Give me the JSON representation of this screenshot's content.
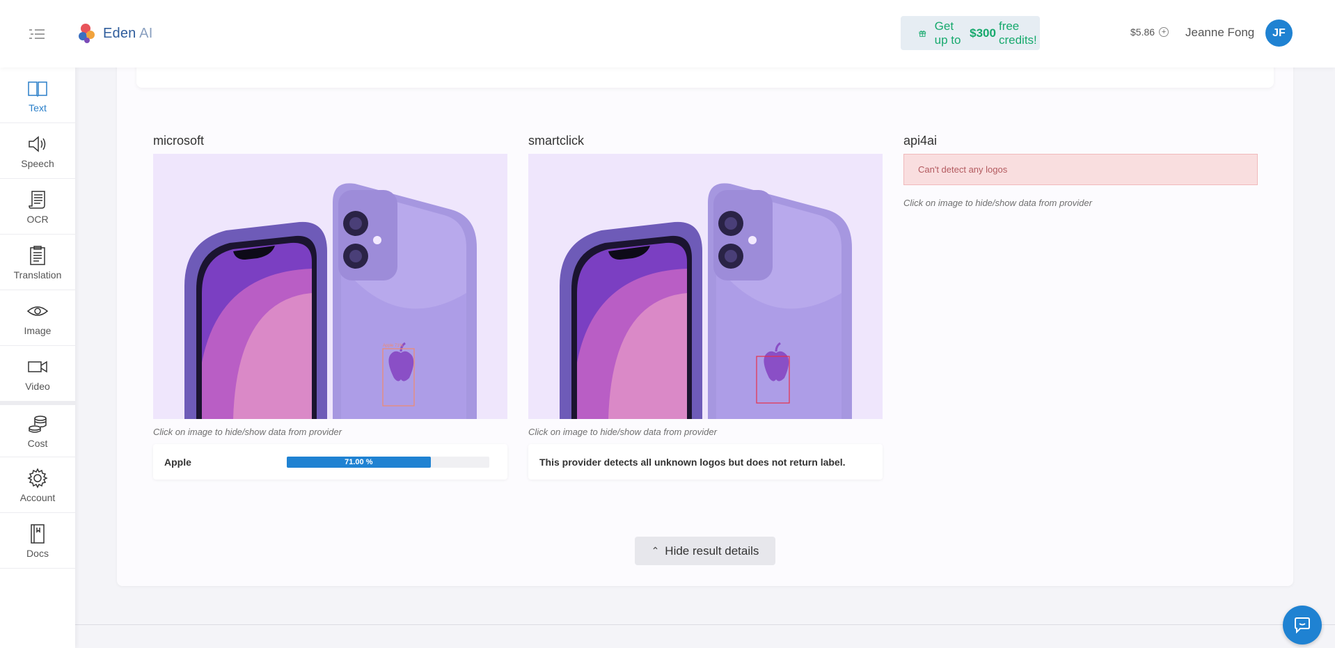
{
  "app": {
    "logo_text": "Eden",
    "logo_suffix": "AI"
  },
  "header": {
    "promo_prefix": "Get up to",
    "promo_amount": "$300",
    "promo_suffix": "free credits!",
    "balance": "$5.86",
    "user_name": "Jeanne Fong",
    "user_initials": "JF"
  },
  "sidebar": {
    "items": [
      {
        "label": "Text",
        "icon": "book-icon",
        "active": true
      },
      {
        "label": "Speech",
        "icon": "speaker-icon"
      },
      {
        "label": "OCR",
        "icon": "scroll-icon"
      },
      {
        "label": "Translation",
        "icon": "clipboard-icon"
      },
      {
        "label": "Image",
        "icon": "eye-icon"
      },
      {
        "label": "Video",
        "icon": "video-camera-icon"
      },
      {
        "label": "Cost",
        "icon": "coins-icon"
      },
      {
        "label": "Account",
        "icon": "gear-icon"
      },
      {
        "label": "Docs",
        "icon": "docs-icon"
      }
    ]
  },
  "providers": [
    {
      "name": "microsoft",
      "hint": "Click on image to hide/show data from provider",
      "result_label": "Apple",
      "confidence": 0.71,
      "confidence_text": "71.00 %"
    },
    {
      "name": "smartclick",
      "hint": "Click on image to hide/show data from provider",
      "result_text": "This provider detects all unknown logos but does not return label."
    },
    {
      "name": "api4ai",
      "alert": "Can't detect any logos",
      "hint": "Click on image to hide/show data from provider"
    }
  ],
  "actions": {
    "hide_results": "Hide result details"
  },
  "colors": {
    "accent": "#1f82d2",
    "promo_green": "#17a96d",
    "alert_bg": "#f9dedf",
    "image_bg": "#efe6fc"
  }
}
